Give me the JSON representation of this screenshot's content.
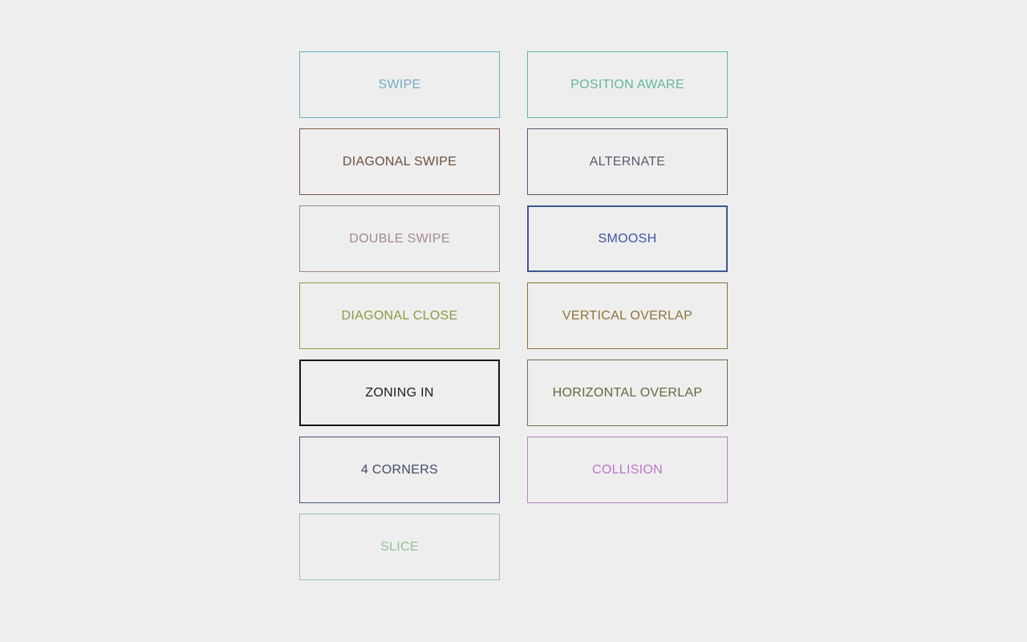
{
  "page": {
    "background_color": "#eeeeee",
    "cell_fill_color": "#efeeee"
  },
  "grid": {
    "columns": 2,
    "cells": [
      {
        "label": "SWIPE",
        "color": "#6fadc2",
        "border_color": "#6fadc2",
        "border_width": 1,
        "column": "left",
        "row": 1
      },
      {
        "label": "POSITION AWARE",
        "color": "#5fb79f",
        "border_color": "#5fb79f",
        "border_width": 1,
        "column": "right",
        "row": 1
      },
      {
        "label": "DIAGONAL SWIPE",
        "color": "#6b5143",
        "border_color": "#7d5a45",
        "border_width": 1,
        "column": "left",
        "row": 2
      },
      {
        "label": "ALTERNATE",
        "color": "#5c5a6e",
        "border_color": "#55556a",
        "border_width": 1,
        "column": "right",
        "row": 2
      },
      {
        "label": "DOUBLE SWIPE",
        "color": "#a18b8b",
        "border_color": "#9e8782",
        "border_width": 1,
        "column": "left",
        "row": 3
      },
      {
        "label": "SMOOSH",
        "color": "#3b57a4",
        "border_color": "#3d5692",
        "border_width": 2,
        "column": "right",
        "row": 3
      },
      {
        "label": "DIAGONAL CLOSE",
        "color": "#8a9a42",
        "border_color": "#8b9a45",
        "border_width": 1,
        "column": "left",
        "row": 4
      },
      {
        "label": "VERTICAL OVERLAP",
        "color": "#8a7438",
        "border_color": "#8a7438",
        "border_width": 1,
        "column": "right",
        "row": 4
      },
      {
        "label": "ZONING IN",
        "color": "#1d1d1d",
        "border_color": "#161616",
        "border_width": 2,
        "column": "left",
        "row": 5
      },
      {
        "label": "HORIZONTAL OVERLAP",
        "color": "#5f6a3c",
        "border_color": "#6a7146",
        "border_width": 1,
        "column": "right",
        "row": 5
      },
      {
        "label": "4 CORNERS",
        "color": "#414a63",
        "border_color": "#47527a",
        "border_width": 1,
        "column": "left",
        "row": 6
      },
      {
        "label": "COLLISION",
        "color": "#b878c6",
        "border_color": "#b782c0",
        "border_width": 1,
        "column": "right",
        "row": 6
      },
      {
        "label": "SLICE",
        "color": "#8cc49a",
        "border_color": "#95c4a1",
        "border_width": 1,
        "column": "left",
        "row": 7
      }
    ]
  }
}
